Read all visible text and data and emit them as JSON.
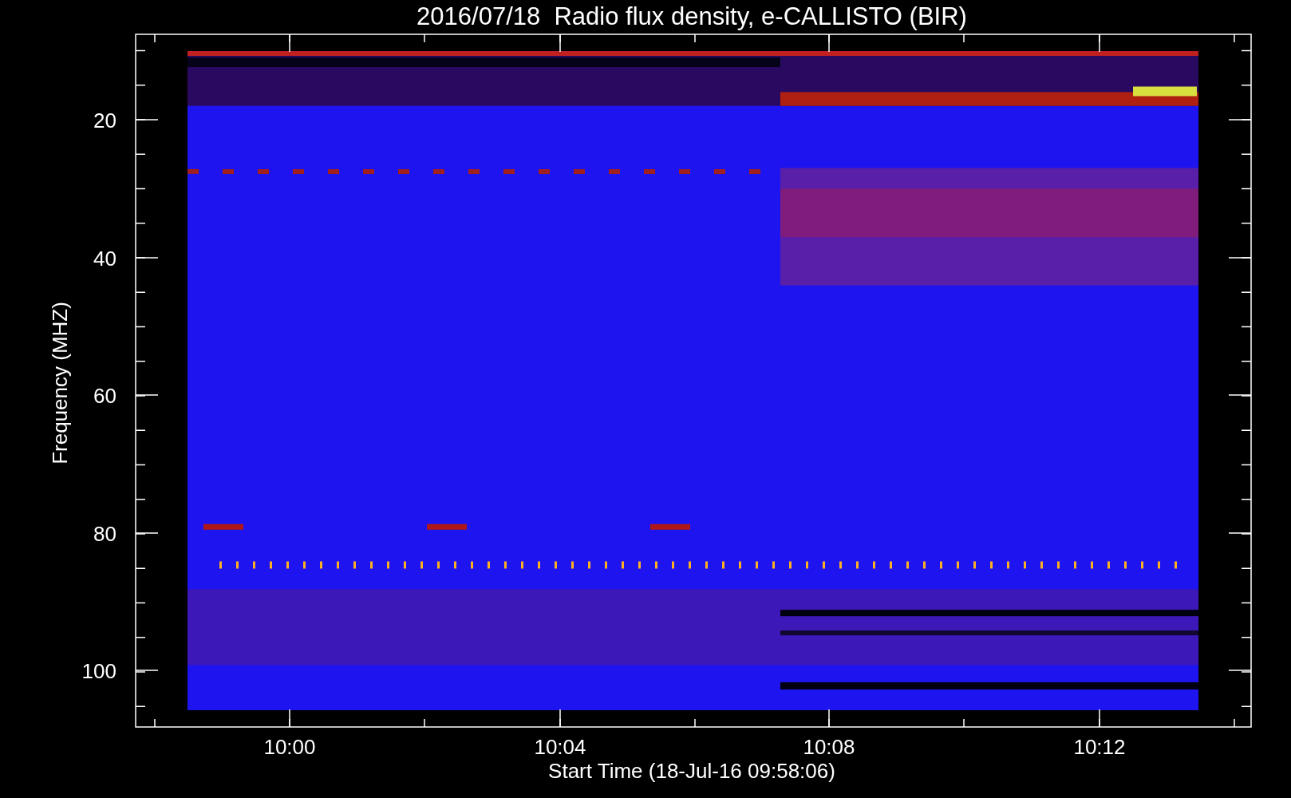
{
  "title": "2016/07/18  Radio flux density, e-CALLISTO (BIR)",
  "y_axis": {
    "label": "Frequency (MHZ)",
    "ticks": [
      "20",
      "40",
      "60",
      "80",
      "100"
    ]
  },
  "x_axis": {
    "label": "Start Time (18-Jul-16 09:58:06)",
    "ticks": [
      "10:00",
      "10:04",
      "10:08",
      "10:12"
    ]
  }
}
